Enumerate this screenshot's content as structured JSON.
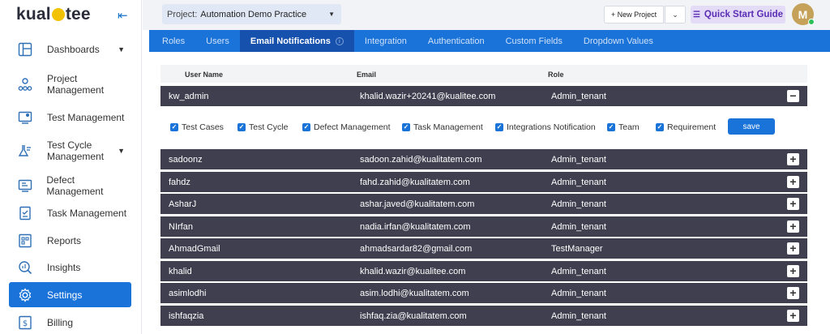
{
  "app": {
    "logo": {
      "pre": "kual",
      "post": "tee"
    }
  },
  "sidebar": {
    "items": [
      {
        "label": "Dashboards",
        "icon": "dashboard-icon",
        "caret": true
      },
      {
        "label": "Project Management",
        "icon": "project-icon",
        "caret": false
      },
      {
        "label": "Test Management",
        "icon": "test-icon",
        "caret": false
      },
      {
        "label": "Test Cycle Management",
        "icon": "cycle-icon",
        "caret": true
      },
      {
        "label": "Defect Management",
        "icon": "defect-icon",
        "caret": false
      },
      {
        "label": "Task Management",
        "icon": "task-icon",
        "caret": false
      },
      {
        "label": "Reports",
        "icon": "reports-icon",
        "caret": false
      },
      {
        "label": "Insights",
        "icon": "insights-icon",
        "caret": false
      },
      {
        "label": "Settings",
        "icon": "gear-icon",
        "caret": false,
        "active": true
      },
      {
        "label": "Billing",
        "icon": "billing-icon",
        "caret": false
      }
    ]
  },
  "topbar": {
    "project_label": "Project:",
    "project_value": "Automation Demo Practice",
    "new_project": "+ New Project",
    "quick_start": "Quick Start Guide",
    "avatar_initial": "M"
  },
  "tabs": [
    "Roles",
    "Users",
    "Email Notifications",
    "Integration",
    "Authentication",
    "Custom Fields",
    "Dropdown Values"
  ],
  "active_tab": "Email Notifications",
  "table": {
    "headers": {
      "user": "User Name",
      "email": "Email",
      "role": "Role"
    },
    "expanded_row": {
      "user": "kw_admin",
      "email": "khalid.wazir+20241@kualitee.com",
      "role": "Admin_tenant"
    },
    "options": [
      "Test Cases",
      "Test Cycle",
      "Defect Management",
      "Task Management",
      "Integrations Notification",
      "Team",
      "Requirement"
    ],
    "save_label": "save",
    "rows": [
      {
        "user": "sadoonz",
        "email": "sadoon.zahid@kualitatem.com",
        "role": "Admin_tenant"
      },
      {
        "user": "fahdz",
        "email": "fahd.zahid@kualitatem.com",
        "role": "Admin_tenant"
      },
      {
        "user": "AsharJ",
        "email": "ashar.javed@kualitatem.com",
        "role": "Admin_tenant"
      },
      {
        "user": "NIrfan",
        "email": "nadia.irfan@kualitatem.com",
        "role": "Admin_tenant"
      },
      {
        "user": "AhmadGmail",
        "email": "ahmadsardar82@gmail.com",
        "role": "TestManager"
      },
      {
        "user": "khalid",
        "email": "khalid.wazir@kualitee.com",
        "role": "Admin_tenant"
      },
      {
        "user": "asimlodhi",
        "email": "asim.lodhi@kualitatem.com",
        "role": "Admin_tenant"
      },
      {
        "user": "ishfaqzia",
        "email": "ishfaq.zia@kualitatem.com",
        "role": "Admin_tenant"
      }
    ]
  },
  "colors": {
    "primary": "#1a73d9",
    "row_bg": "#3f3f4f",
    "accent_purple": "#5b2db4"
  }
}
